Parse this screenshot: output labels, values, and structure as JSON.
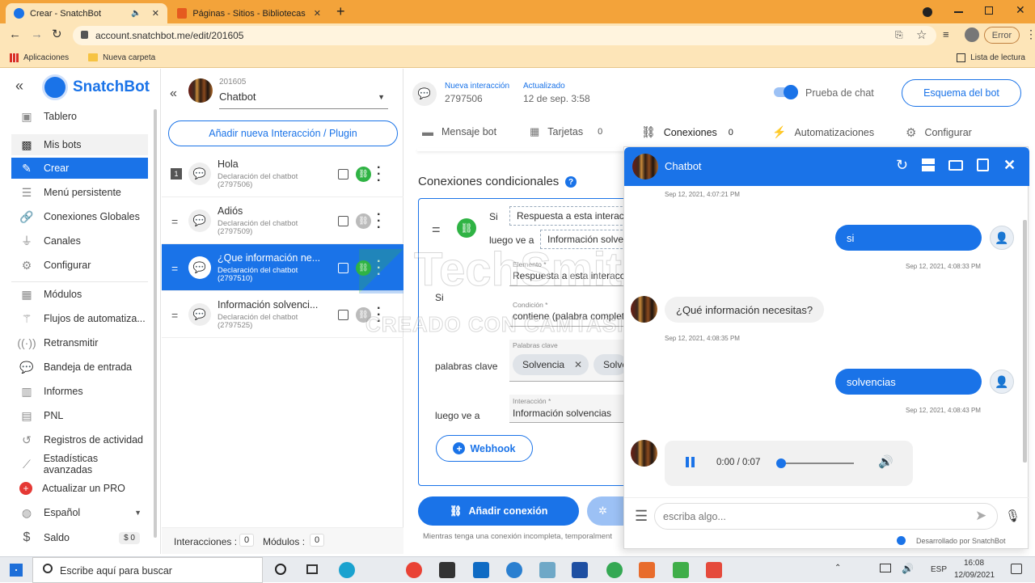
{
  "browser": {
    "tabs": [
      {
        "title": "Crear - SnatchBot",
        "active": true
      },
      {
        "title": "Páginas - Sitios - Bibliotecas digit",
        "active": false
      }
    ],
    "new_tab": "+",
    "url": "account.snatchbot.me/edit/201605",
    "error_label": "Error",
    "bookmarks": [
      "Aplicaciones",
      "Nueva carpeta"
    ],
    "reading_list": "Lista de lectura"
  },
  "sidebar": {
    "brand": "SnatchBot",
    "collapse": "«",
    "items": [
      {
        "label": "Tablero",
        "icon": "dashboard-icon"
      },
      {
        "label": "Mis bots",
        "icon": "bot-icon"
      },
      {
        "label": "Crear",
        "icon": "edit-icon"
      },
      {
        "label": "Menú persistente",
        "icon": "menu-icon"
      },
      {
        "label": "Conexiones Globales",
        "icon": "link-icon"
      },
      {
        "label": "Canales",
        "icon": "plug-icon"
      },
      {
        "label": "Configurar",
        "icon": "gear-icon"
      },
      {
        "label": "Módulos",
        "icon": "modules-icon"
      },
      {
        "label": "Flujos de automatiza...",
        "icon": "wand-icon"
      },
      {
        "label": "Retransmitir",
        "icon": "broadcast-icon"
      },
      {
        "label": "Bandeja de entrada",
        "icon": "inbox-icon"
      },
      {
        "label": "Informes",
        "icon": "reports-icon"
      },
      {
        "label": "PNL",
        "icon": "nlp-icon"
      },
      {
        "label": "Registros de actividad",
        "icon": "history-icon"
      },
      {
        "label": "Estadísticas avanzadas",
        "icon": "stats-icon"
      },
      {
        "label": "Actualizar un PRO",
        "icon": "plus-circle-icon"
      },
      {
        "label": "Español",
        "icon": "globe-icon"
      },
      {
        "label": "Saldo",
        "icon": "dollar-icon"
      }
    ],
    "balance": "$ 0"
  },
  "bot": {
    "id": "201605",
    "name": "Chatbot",
    "add_button": "Añadir nueva Interacción / Plugin",
    "interactions": [
      {
        "index": "1",
        "title": "Hola",
        "subtitle": "Declaración del chatbot",
        "id": "(2797506)"
      },
      {
        "index": "",
        "title": "Adiós",
        "subtitle": "Declaración del chatbot",
        "id": "(2797509)"
      },
      {
        "index": "",
        "title": "¿Que información ne...",
        "subtitle": "Declaración del chatbot",
        "id": "(2797510)"
      },
      {
        "index": "",
        "title": "Información solvenci...",
        "subtitle": "Declaración del chatbot",
        "id": "(2797525)"
      }
    ],
    "footer_interactions_label": "Interacciones :",
    "footer_interactions_count": "0",
    "footer_modules_label": "Módulos :",
    "footer_modules_count": "0"
  },
  "header": {
    "new_label": "Nueva interacción",
    "new_id": "2797506",
    "updated_label": "Actualizado",
    "updated_value": "12 de sep. 3:58",
    "test_toggle": "Prueba de chat",
    "scheme_button": "Esquema del bot"
  },
  "tabs": [
    {
      "label": "Mensaje bot",
      "count": ""
    },
    {
      "label": "Tarjetas",
      "count": "0"
    },
    {
      "label": "Conexiones",
      "count": "0"
    },
    {
      "label": "Automatizaciones",
      "count": ""
    },
    {
      "label": "Configurar",
      "count": ""
    }
  ],
  "connections": {
    "title": "Conexiones condicionales",
    "if_label": "Si",
    "if_value": "Respuesta a esta interacc",
    "then_label": "luego ve a",
    "then_value": "Información solve",
    "element_label": "Elemento *",
    "element_value": "Respuesta a esta interacció",
    "si_label": "Si",
    "condition_label": "Condición *",
    "condition_value": "contiene (palabra complete",
    "keywords_row_label": "palabras clave",
    "keywords_field_label": "Palabras clave",
    "keywords": [
      "Solvencia",
      "Solve"
    ],
    "goto_label": "luego ve a",
    "interaction_label": "Interacción *",
    "interaction_value": "Información solvencias",
    "webhook_button": "Webhook",
    "add_connection_button": "Añadir conexión",
    "footer_note": "Mientras tenga una conexión incompleta, temporalment"
  },
  "chat": {
    "title": "Chatbot",
    "messages": [
      {
        "from": "meta",
        "time": "Sep 12, 2021, 4:07:21 PM"
      },
      {
        "from": "user",
        "text": "si",
        "time": "Sep 12, 2021, 4:08:33 PM"
      },
      {
        "from": "bot",
        "text": "¿Qué información necesitas?",
        "time": "Sep 12, 2021, 4:08:35 PM"
      },
      {
        "from": "user",
        "text": "solvencias",
        "time": "Sep 12, 2021, 4:08:43 PM"
      }
    ],
    "audio_time": "0:00 / 0:07",
    "audio_progress": 0.02,
    "input_placeholder": "escriba algo...",
    "powered_by": "Desarrollado por SnatchBot"
  },
  "watermark": {
    "line1": "TechSmith",
    "line2": "CREADO CON CAMTASIA"
  },
  "taskbar": {
    "search_placeholder": "Escribe aquí para buscar",
    "lang": "ESP",
    "time": "16:08",
    "date": "12/09/2021"
  },
  "colors": {
    "brand": "#1a73e8",
    "chrome": "#f3a33a",
    "chrome_light": "#fde5b8",
    "link_green": "#2fb344"
  }
}
